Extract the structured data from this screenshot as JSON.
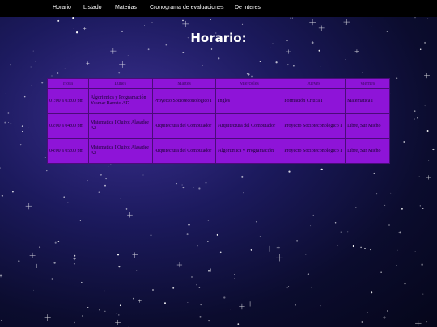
{
  "nav": {
    "items": [
      "Horario",
      "Listado",
      "Materias",
      "Cronograma de evaluaciones",
      "De interes"
    ]
  },
  "page": {
    "title": "Horario:"
  },
  "schedule": {
    "headers": [
      "Hora",
      "Lunes",
      "Martes",
      "Miercoles",
      "Jueves",
      "Viernes"
    ],
    "rows": [
      [
        "01:00 a 03:00 pm",
        "Algoritmica y Programación Yosmar Barreto AI7",
        "Proyecto Socioteconologico I",
        "Ingles",
        "Formación Critica I",
        "Matematica I"
      ],
      [
        "03:00 a 04:00 pm",
        "Matematica I Quirot Alasadee A2",
        "Arquitectura del Computador",
        "Arquitectura del Computador",
        "Proyecto Socioteconologico I",
        "Libre, Sur Micho"
      ],
      [
        "04:00 a 05:00 pm",
        "Matematica I Quirot Alasadee A2",
        "Arquitectura del Computador",
        "Algoritmica y Programación",
        "Proyecto Socioteconologico I",
        "Libre, Sur Micho"
      ]
    ]
  },
  "colors": {
    "table_bg": "#8e14d8",
    "nav_bg": "#000000",
    "sky": "#1c1a5e"
  }
}
